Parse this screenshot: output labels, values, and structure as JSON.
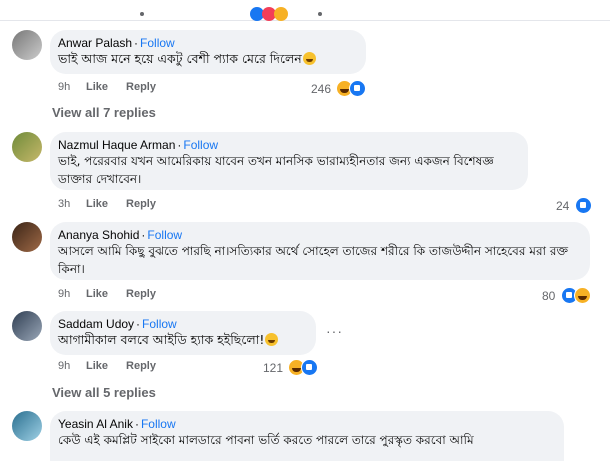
{
  "comments": [
    {
      "name": "Anwar Palash",
      "follow": "Follow",
      "text": "ভাই আজ মনে হয়ে একটু বেশী প্যাক মেরে দিলেন",
      "time": "9h",
      "like": "Like",
      "reply": "Reply",
      "reaction_count": "246"
    },
    {
      "name": "Nazmul Haque Arman",
      "follow": "Follow",
      "text": "ভাই, পরেরবার যখন আমেরিকায় যাবেন তখন মানসিক ভারাম্যহীনতার জন্য একজন বিশেষজ্ঞ ডাক্তার দেখাবেন।",
      "time": "3h",
      "like": "Like",
      "reply": "Reply",
      "reaction_count": "24"
    },
    {
      "name": "Ananya Shohid",
      "follow": "Follow",
      "text": "আসলে আমি কিছু বুঝতে পারছি না।সত্যিকার অর্থে সোহেল তাজের শরীরে কি তাজউদ্দীন সাহেবের মরা রক্ত কিনা।",
      "time": "9h",
      "like": "Like",
      "reply": "Reply",
      "reaction_count": "80"
    },
    {
      "name": "Saddam Udoy",
      "follow": "Follow",
      "text": "আগামীকাল বলবে আইডি হ্যাক হইছিলো!",
      "time": "9h",
      "like": "Like",
      "reply": "Reply",
      "reaction_count": "121"
    },
    {
      "name": "Yeasin Al Anik",
      "follow": "Follow",
      "text": "কেউ এই কমপ্লিট সাইকো মালডারে পাবনা ভর্তি করতে পারলে তারে পুরস্কৃত করবো আমি"
    }
  ],
  "view_replies": [
    {
      "label": "View all 7 replies"
    },
    {
      "label": "View all 5 replies"
    }
  ],
  "follow_sep": "·",
  "more_label": "···",
  "icons": {
    "like": "like-reaction-icon",
    "haha": "haha-reaction-icon",
    "emoji": "grinning-emoji-icon"
  },
  "colors": {
    "link": "#1877f2",
    "bubble": "#f0f2f5",
    "meta": "#65676b"
  }
}
